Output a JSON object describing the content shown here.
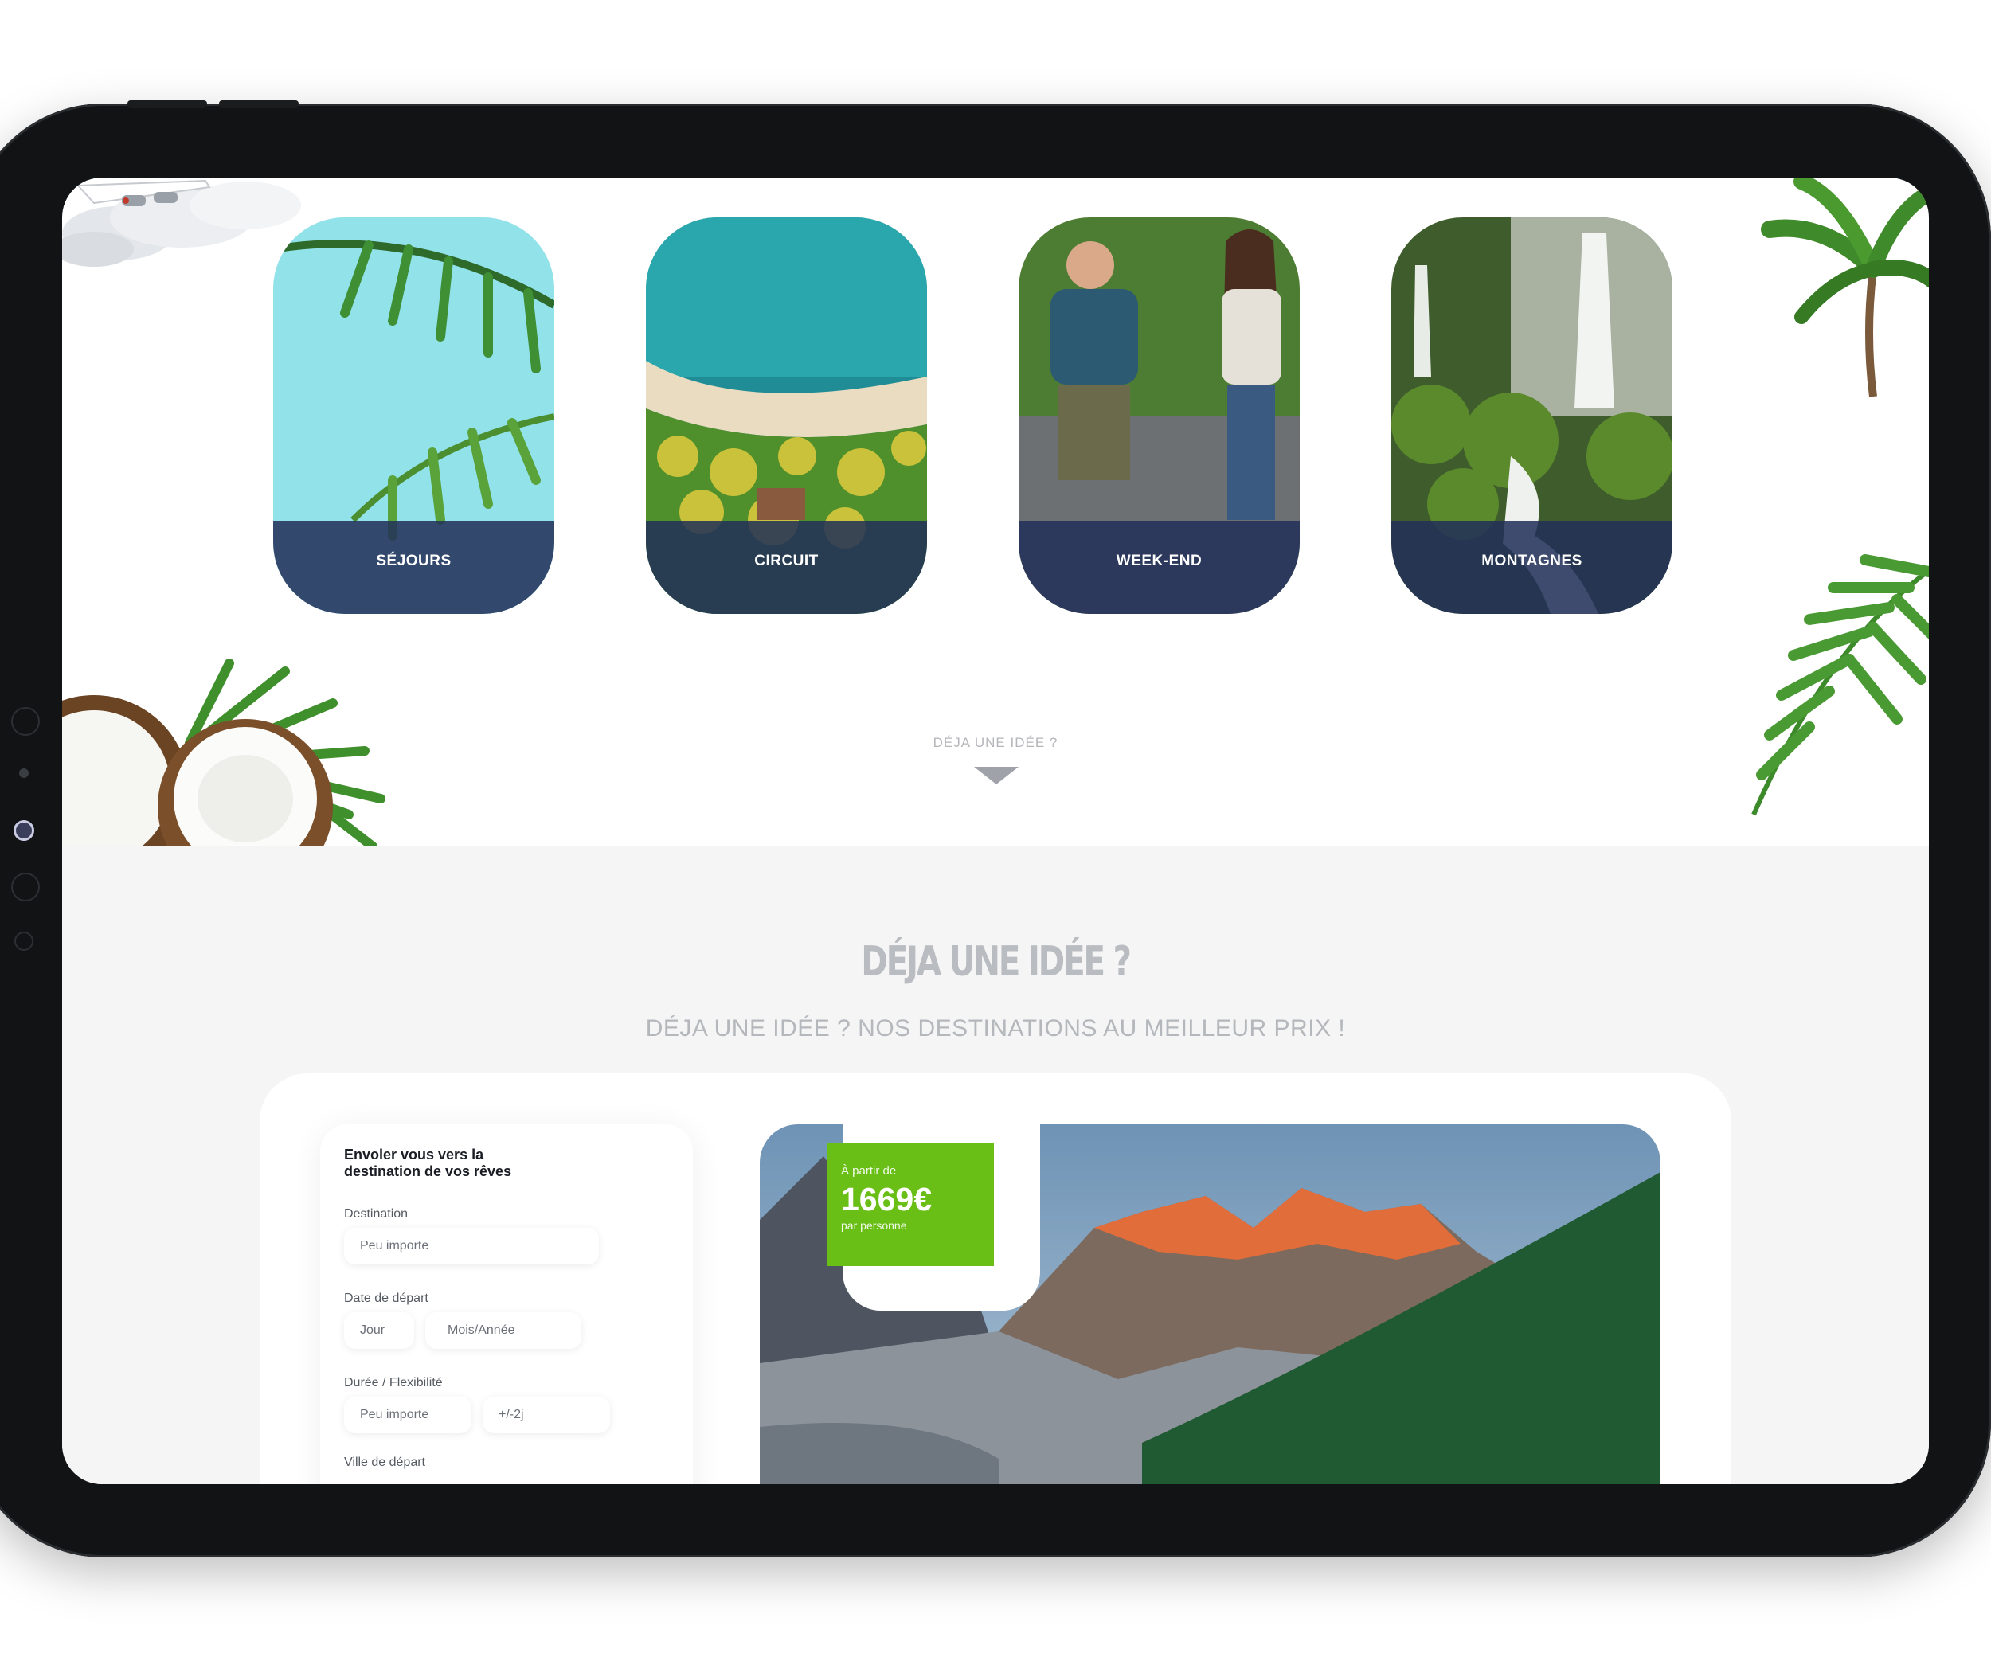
{
  "categories": [
    {
      "label": "SÉJOURS"
    },
    {
      "label": "CIRCUIT"
    },
    {
      "label": "WEEK-END"
    },
    {
      "label": "MONTAGNES"
    }
  ],
  "scroll_hint": "DÉJA UNE IDÉE ?",
  "section": {
    "title": "DÉJA UNE IDÉE ?",
    "subtitle": "DÉJA UNE IDÉE ? NOS DESTINATIONS AU MEILLEUR PRIX !"
  },
  "search": {
    "title": "Envoler vous vers la destination de vos rêves",
    "destination_label": "Destination",
    "destination_value": "Peu importe",
    "date_label": "Date de départ",
    "day_value": "Jour",
    "month_value": "Mois/Année",
    "duration_label": "Durée / Flexibilité",
    "duration_value": "Peu importe",
    "flex_value": "+/-2j",
    "departure_city_label": "Ville de départ"
  },
  "offer": {
    "from_label": "À partir de",
    "price": "1669€",
    "per_label": "par personne"
  },
  "colors": {
    "card_bar": "#223058",
    "price_badge": "#6abf16",
    "grey_bg": "#f5f5f5"
  }
}
